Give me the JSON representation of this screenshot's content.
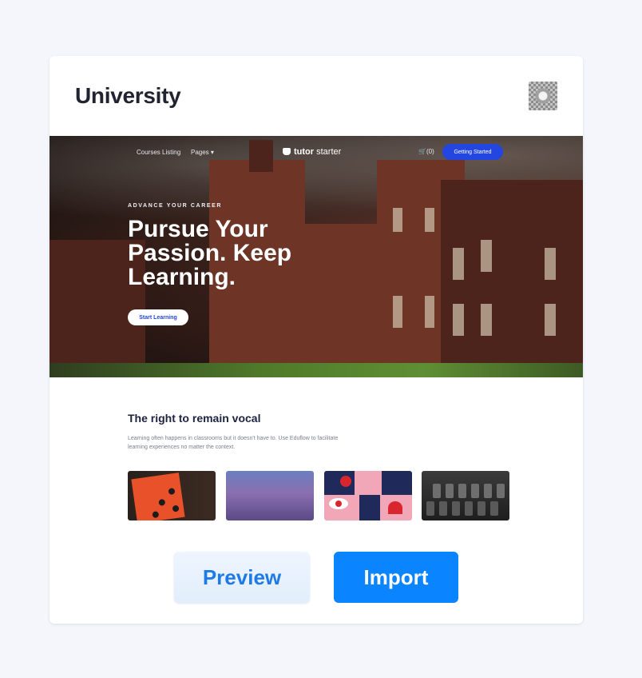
{
  "card": {
    "title": "University",
    "settings_icon": "gear-icon"
  },
  "preview": {
    "nav": {
      "links": [
        "Courses Listing",
        "Pages ▾"
      ],
      "brand_bold": "tutor",
      "brand_rest": " starter",
      "cart": "🛒(0)",
      "cta": "Getting Started"
    },
    "hero": {
      "eyebrow": "ADVANCE YOUR CAREER",
      "title": "Pursue Your Passion. Keep Learning.",
      "button": "Start Learning"
    },
    "section": {
      "title": "The right to remain vocal",
      "text": "Learning often happens in classrooms but it doesn't have to. Use Eduflow to facilitate learning experiences no matter the context."
    }
  },
  "actions": {
    "preview_label": "Preview",
    "import_label": "Import"
  },
  "colors": {
    "accent": "#0a84ff",
    "nav_cta": "#2446e0",
    "page_bg": "#f4f6fb"
  }
}
